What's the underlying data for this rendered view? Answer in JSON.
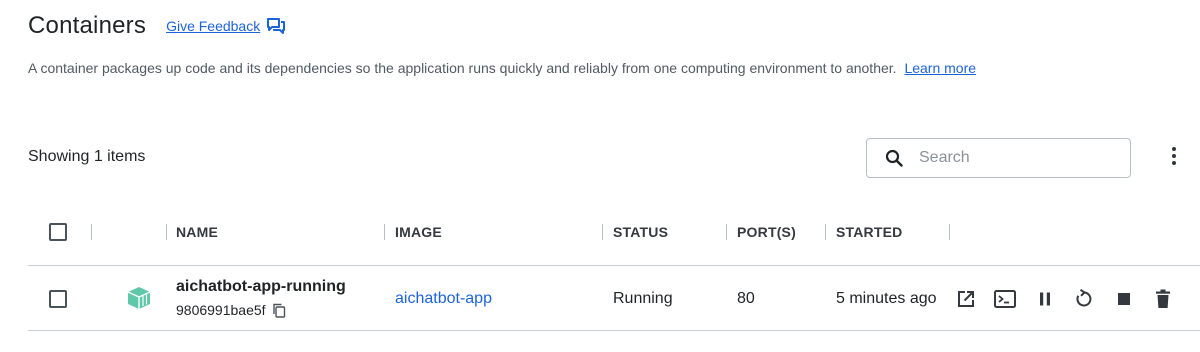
{
  "header": {
    "title": "Containers",
    "feedback_label": "Give Feedback",
    "description": "A container packages up code and its dependencies so the application runs quickly and reliably from one computing environment to another.",
    "learn_more": "Learn more"
  },
  "toolbar": {
    "showing": "Showing 1 items",
    "search_placeholder": "Search"
  },
  "table": {
    "columns": [
      "NAME",
      "IMAGE",
      "STATUS",
      "PORT(S)",
      "STARTED"
    ],
    "rows": [
      {
        "name": "aichatbot-app-running",
        "id": "9806991bae5f",
        "image": "aichatbot-app",
        "status": "Running",
        "ports": "80",
        "started": "5 minutes ago"
      }
    ]
  },
  "icons": {
    "feedback": "chat-bubbles-icon",
    "search": "search-icon",
    "more": "vertical-dots-icon",
    "container": "container-cube-icon",
    "copy": "copy-icon",
    "actions": [
      "open-external-icon",
      "terminal-icon",
      "pause-icon",
      "restart-icon",
      "stop-icon",
      "delete-icon"
    ]
  },
  "colors": {
    "accent": "#1d63d8",
    "container_icon": "#5fc8a8",
    "text": "#1f2326",
    "muted": "#505a63"
  }
}
